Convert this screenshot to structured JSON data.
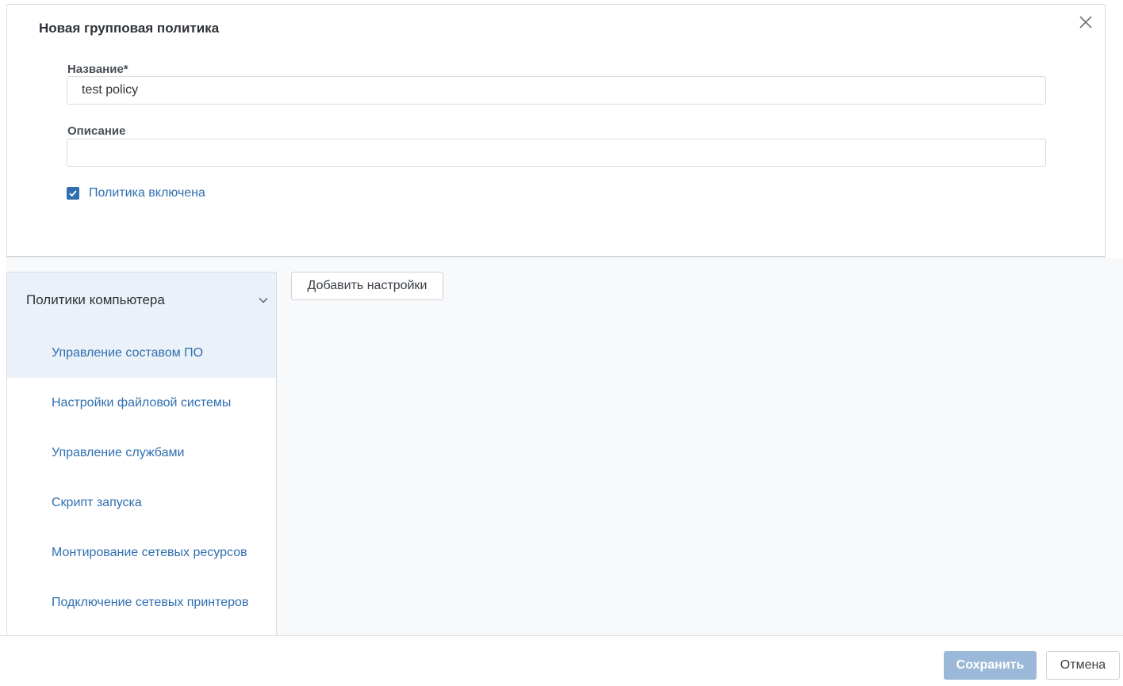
{
  "dialog": {
    "title": "Новая групповая политика",
    "close_icon": "close-icon"
  },
  "form": {
    "name_label": "Название*",
    "name_value": "test policy",
    "description_label": "Описание",
    "description_value": "",
    "enabled_label": "Политика включена",
    "enabled_checked": true
  },
  "sidebar": {
    "title": "Политики компьютера",
    "chevron_icon": "chevron-down-icon",
    "items": [
      {
        "label": "Управление составом ПО",
        "active": true
      },
      {
        "label": "Настройки файловой системы",
        "active": false
      },
      {
        "label": "Управление службами",
        "active": false
      },
      {
        "label": "Скрипт запуска",
        "active": false
      },
      {
        "label": "Монтирование сетевых ресурсов",
        "active": false
      },
      {
        "label": "Подключение сетевых принтеров",
        "active": false
      }
    ]
  },
  "main": {
    "add_settings_label": "Добавить настройки"
  },
  "footer": {
    "save_label": "Сохранить",
    "save_disabled": true,
    "cancel_label": "Отмена"
  },
  "colors": {
    "accent": "#2f6fb0",
    "active_bg": "#ebf1f8",
    "save_disabled_bg": "#9bb8d8"
  }
}
